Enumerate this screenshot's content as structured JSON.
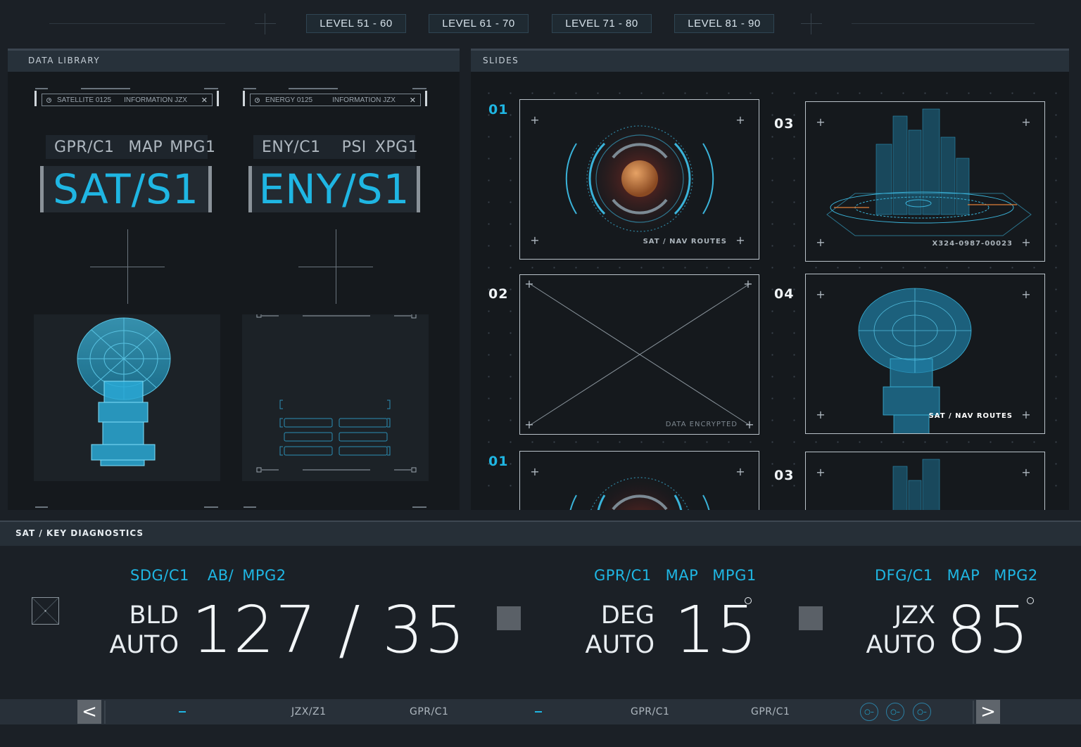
{
  "top_tabs": [
    "LEVEL 51 - 60",
    "LEVEL 61 - 70",
    "LEVEL 71 - 80",
    "LEVEL 81 - 90"
  ],
  "data_library": {
    "title": "DATA LIBRARY",
    "cards": [
      {
        "tag_left": "SATELLITE 0125",
        "tag_right": "INFORMATION JZX",
        "close": "✕",
        "subcodes": [
          "GPR/C1",
          "MAP",
          "MPG1"
        ],
        "code": "SAT/S1",
        "image": "satellite-dish"
      },
      {
        "tag_left": "ENERGY 0125",
        "tag_right": "INFORMATION JZX",
        "close": "✕",
        "subcodes": [
          "ENY/C1",
          "PSI",
          "XPG1"
        ],
        "code": "ENY/S1",
        "image": "placeholder-wireframe"
      }
    ]
  },
  "slides": {
    "title": "SLIDES",
    "items": [
      {
        "number": "01",
        "caption": "SAT / NAV ROUTES",
        "image": "planet-radar"
      },
      {
        "number": "03",
        "caption": "X324-0987-00023",
        "image": "city-hologram"
      },
      {
        "number": "02",
        "caption": "DATA ENCRYPTED",
        "image": "encrypted-placeholder"
      },
      {
        "number": "04",
        "caption": "SAT / NAV ROUTES",
        "image": "satellite-dish"
      },
      {
        "number": "01",
        "caption": "",
        "image": "planet-radar"
      },
      {
        "number": "03",
        "caption": "",
        "image": "city-hologram"
      }
    ]
  },
  "diagnostics": {
    "title": "SAT / KEY DIAGNOSTICS",
    "readouts": [
      {
        "codes": [
          "SDG/C1",
          "AB/",
          "MPG2"
        ],
        "unit_top": "BLD",
        "unit_bottom": "AUTO",
        "value": "127 / 35"
      },
      {
        "codes": [
          "GPR/C1",
          "MAP",
          "MPG1"
        ],
        "unit_top": "DEG",
        "unit_bottom": "AUTO",
        "value": "15"
      },
      {
        "codes": [
          "DFG/C1",
          "MAP",
          "MPG2"
        ],
        "unit_top": "JZX",
        "unit_bottom": "AUTO",
        "value": "85"
      }
    ]
  },
  "bottom_bar": {
    "prev": "<",
    "next": ">",
    "items": [
      "JZX/Z1",
      "GPR/C1",
      "GPR/C1",
      "GPR/C1"
    ],
    "icons": [
      "key-icon",
      "key-icon",
      "key-icon"
    ]
  },
  "colors": {
    "accent": "#1fb6e3",
    "background": "#1b2026",
    "panel": "#15191d",
    "header": "#27313a"
  }
}
